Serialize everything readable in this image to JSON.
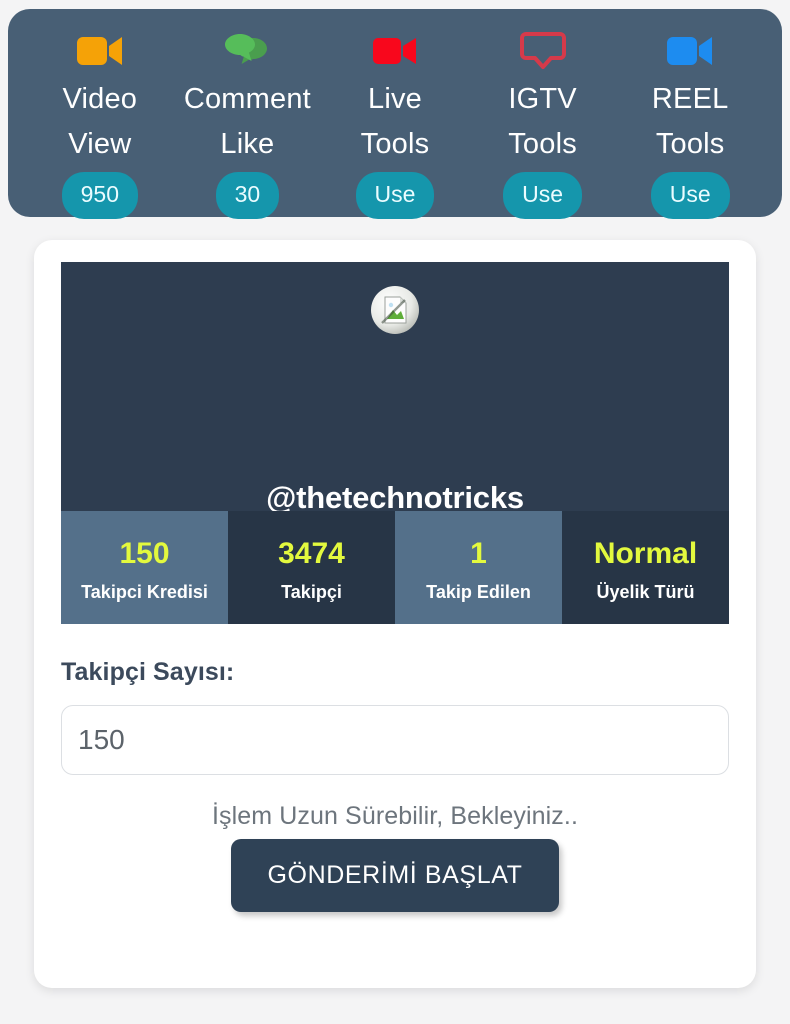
{
  "toolbar": {
    "background_color": "#485f75",
    "pill_color": "#1596ac",
    "items": [
      {
        "icon": "video-camera-icon",
        "icon_color": "#f5a207",
        "line1": "Video",
        "line2": "View",
        "pill": "950"
      },
      {
        "icon": "comment-bubbles-icon",
        "icon_color": "#4cb050",
        "line1": "Comment",
        "line2": "Like",
        "pill": "30"
      },
      {
        "icon": "live-video-camera-icon",
        "icon_color": "#f8071c",
        "line1": "Live",
        "line2": "Tools",
        "pill": "Use"
      },
      {
        "icon": "igtv-tv-icon",
        "icon_color": "#d63a4a",
        "line1": "IGTV",
        "line2": "Tools",
        "pill": "Use"
      },
      {
        "icon": "reel-video-camera-icon",
        "icon_color": "#1d8cf0",
        "line1": "REEL",
        "line2": "Tools",
        "pill": "Use"
      }
    ]
  },
  "profile": {
    "avatar_icon": "broken-image-placeholder-icon",
    "handle": "@thetechnotricks",
    "panel_color": "#2e3d50",
    "value_color": "#e3f93e",
    "stats": [
      {
        "value": "150",
        "label": "Takipci Kredisi"
      },
      {
        "value": "3474",
        "label": "Takipçi"
      },
      {
        "value": "1",
        "label": "Takip Edilen"
      },
      {
        "value": "Normal",
        "label": "Üyelik Türü"
      }
    ]
  },
  "form": {
    "field_label": "Takipçi Sayısı:",
    "input_value": "150",
    "input_placeholder": "150",
    "notice": "İşlem Uzun Sürebilir, Bekleyiniz..",
    "submit_label": "GÖNDERİMİ BAŞLAT",
    "submit_color": "#2f4256"
  }
}
